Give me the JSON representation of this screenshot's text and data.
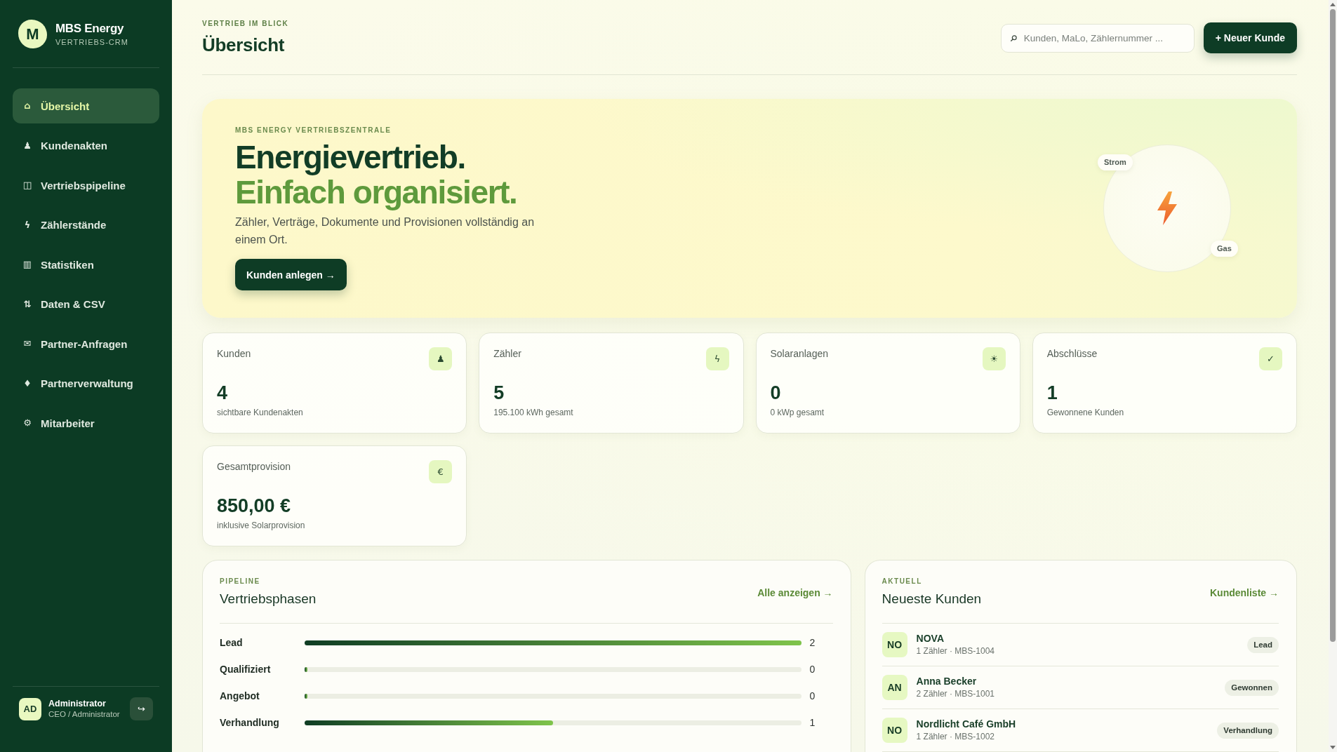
{
  "sidebar": {
    "brand": {
      "logo_letter": "M",
      "name": "MBS Energy",
      "tagline": "VERTRIEBS-CRM"
    },
    "items": [
      {
        "icon": "⌂",
        "label": "Übersicht",
        "selected": true
      },
      {
        "icon": "♟",
        "label": "Kundenakten",
        "selected": false
      },
      {
        "icon": "◫",
        "label": "Vertriebspipeline",
        "selected": false
      },
      {
        "icon": "ϟ",
        "label": "Zählerstände",
        "selected": false
      },
      {
        "icon": "▥",
        "label": "Statistiken",
        "selected": false
      },
      {
        "icon": "⇅",
        "label": "Daten & CSV",
        "selected": false
      },
      {
        "icon": "✉",
        "label": "Partner-Anfragen",
        "selected": false
      },
      {
        "icon": "♦",
        "label": "Partnerverwaltung",
        "selected": false
      },
      {
        "icon": "⚙",
        "label": "Mitarbeiter",
        "selected": false
      }
    ],
    "user": {
      "initials": "AD",
      "name": "Administrator",
      "role": "CEO / Administrator",
      "logout_icon": "↪"
    }
  },
  "header": {
    "kicker": "VERTRIEB IM BLICK",
    "title": "Übersicht",
    "search": {
      "placeholder": "Kunden, MaLo, Zählernummer ..."
    },
    "new_button": "+ Neuer Kunde"
  },
  "hero": {
    "kicker": "MBS ENERGY VERTRIEBSZENTRALE",
    "headline": "Energievertrieb.",
    "headline_accent": "Einfach organisiert.",
    "text": "Zähler, Verträge, Dokumente und Provisionen vollständig an einem Ort.",
    "button": "Kunden anlegen →",
    "energy_tags": [
      "Strom",
      "Gas"
    ]
  },
  "stats": [
    {
      "label": "Kunden",
      "icon": "♟",
      "value": "4",
      "caption": "sichtbare Kundenakten"
    },
    {
      "label": "Zähler",
      "icon": "ϟ",
      "value": "5",
      "caption": "195.100 kWh gesamt"
    },
    {
      "label": "Solaranlagen",
      "icon": "☀",
      "value": "0",
      "caption": "0 kWp gesamt"
    },
    {
      "label": "Abschlüsse",
      "icon": "✓",
      "value": "1",
      "caption": "Gewonnene Kunden"
    },
    {
      "label": "Gesamtprovision",
      "icon": "€",
      "value": "850,00 €",
      "caption": "inklusive Solarprovision"
    }
  ],
  "pipeline": {
    "kicker": "PIPELINE",
    "title": "Vertriebsphasen",
    "link": "Alle anzeigen →",
    "stages": [
      {
        "name": "Lead",
        "level": 1,
        "count": "2"
      },
      {
        "name": "Qualifiziert",
        "level": 0,
        "count": "0"
      },
      {
        "name": "Angebot",
        "level": 0,
        "count": "0"
      },
      {
        "name": "Verhandlung",
        "level": 0.5,
        "count": "1"
      }
    ]
  },
  "recent": {
    "kicker": "AKTUELL",
    "title": "Neueste Kunden",
    "link": "Kundenliste →",
    "customers": [
      {
        "initials": "NO",
        "name": "NOVA",
        "meta": "1 Zähler · MBS-1004",
        "status": "Lead"
      },
      {
        "initials": "AN",
        "name": "Anna Becker",
        "meta": "2 Zähler · MBS-1001",
        "status": "Gewonnen"
      },
      {
        "initials": "NO",
        "name": "Nordlicht Café GmbH",
        "meta": "1 Zähler · MBS-1002",
        "status": "Verhandlung"
      }
    ]
  }
}
